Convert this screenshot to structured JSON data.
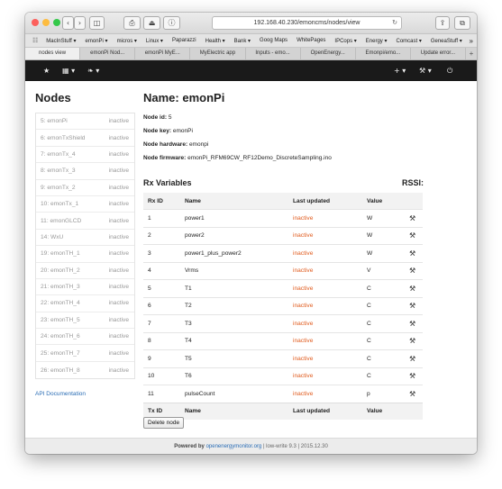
{
  "browser": {
    "url": "192.168.40.230/emoncms/nodes/view",
    "bookmarks": [
      "MacInStuff ▾",
      "emonPi ▾",
      "micros ▾",
      "Linux ▾",
      "Paparazzi",
      "Health ▾",
      "Bank ▾",
      "Goog Maps",
      "WhitePages",
      "IPCops ▾",
      "Energy ▾",
      "Comcast ▾",
      "GeneaStuff ▾"
    ],
    "tabs": [
      "nodes view",
      "emonPi Nod...",
      "emonPi MyE...",
      "MyElectric app",
      "Inputs - emo...",
      "OpenEnergy...",
      "Emonpi/emo...",
      "Update error..."
    ],
    "active_tab": 0,
    "icons": {
      "bookmarks_grid": "☷",
      "more": "»",
      "reload": "↻",
      "new_tab": "+"
    }
  },
  "navbar": {
    "star": "★",
    "apps": "▦ ▾",
    "leaf": "❧ ▾",
    "plus": "+ ▾",
    "wrench": "⚒ ▾",
    "power": "⏻"
  },
  "sidebar": {
    "title": "Nodes",
    "nodes": [
      {
        "label": "5: emonPi",
        "status": "inactive"
      },
      {
        "label": "6: emonTxShield",
        "status": "inactive"
      },
      {
        "label": "7: emonTx_4",
        "status": "inactive"
      },
      {
        "label": "8: emonTx_3",
        "status": "inactive"
      },
      {
        "label": "9: emonTx_2",
        "status": "inactive"
      },
      {
        "label": "10: emonTx_1",
        "status": "inactive"
      },
      {
        "label": "11: emonGLCD",
        "status": "inactive"
      },
      {
        "label": "14: WxU",
        "status": "inactive"
      },
      {
        "label": "19: emonTH_1",
        "status": "inactive"
      },
      {
        "label": "20: emonTH_2",
        "status": "inactive"
      },
      {
        "label": "21: emonTH_3",
        "status": "inactive"
      },
      {
        "label": "22: emonTH_4",
        "status": "inactive"
      },
      {
        "label": "23: emonTH_5",
        "status": "inactive"
      },
      {
        "label": "24: emonTH_6",
        "status": "inactive"
      },
      {
        "label": "25: emonTH_7",
        "status": "inactive"
      },
      {
        "label": "26: emonTH_8",
        "status": "inactive"
      }
    ],
    "api_link": "API Documentation"
  },
  "main": {
    "title": "Name: emonPi",
    "info": [
      {
        "label": "Node id:",
        "value": "5"
      },
      {
        "label": "Node key:",
        "value": "emonPi"
      },
      {
        "label": "Node hardware:",
        "value": "emonpi"
      },
      {
        "label": "Node firmware:",
        "value": "emonPi_RFM69CW_RF12Demo_DiscreteSampling.ino"
      }
    ],
    "rx_title": "Rx Variables",
    "rssi_label": "RSSI:",
    "columns": [
      "Rx ID",
      "Name",
      "Last updated",
      "Value"
    ],
    "footer_columns": [
      "Tx ID",
      "Name",
      "Last updated",
      "Value"
    ],
    "rows": [
      {
        "id": "1",
        "name": "power1",
        "last": "inactive",
        "value": "W"
      },
      {
        "id": "2",
        "name": "power2",
        "last": "inactive",
        "value": "W"
      },
      {
        "id": "3",
        "name": "power1_plus_power2",
        "last": "inactive",
        "value": "W"
      },
      {
        "id": "4",
        "name": "Vrms",
        "last": "inactive",
        "value": "V"
      },
      {
        "id": "5",
        "name": "T1",
        "last": "inactive",
        "value": "C"
      },
      {
        "id": "6",
        "name": "T2",
        "last": "inactive",
        "value": "C"
      },
      {
        "id": "7",
        "name": "T3",
        "last": "inactive",
        "value": "C"
      },
      {
        "id": "8",
        "name": "T4",
        "last": "inactive",
        "value": "C"
      },
      {
        "id": "9",
        "name": "T5",
        "last": "inactive",
        "value": "C"
      },
      {
        "id": "10",
        "name": "T6",
        "last": "inactive",
        "value": "C"
      },
      {
        "id": "11",
        "name": "pulseCount",
        "last": "inactive",
        "value": "p"
      }
    ],
    "edit_icon": "⚒",
    "delete_button": "Delete node"
  },
  "footer": {
    "prefix": "Powered by",
    "link": "openenergymonitor.org",
    "version": "| low-write 9.3 | 2015.12.30"
  },
  "colors": {
    "inactive": "#e05a1c",
    "link": "#2a6db5",
    "navbar": "#1a1a1a"
  }
}
